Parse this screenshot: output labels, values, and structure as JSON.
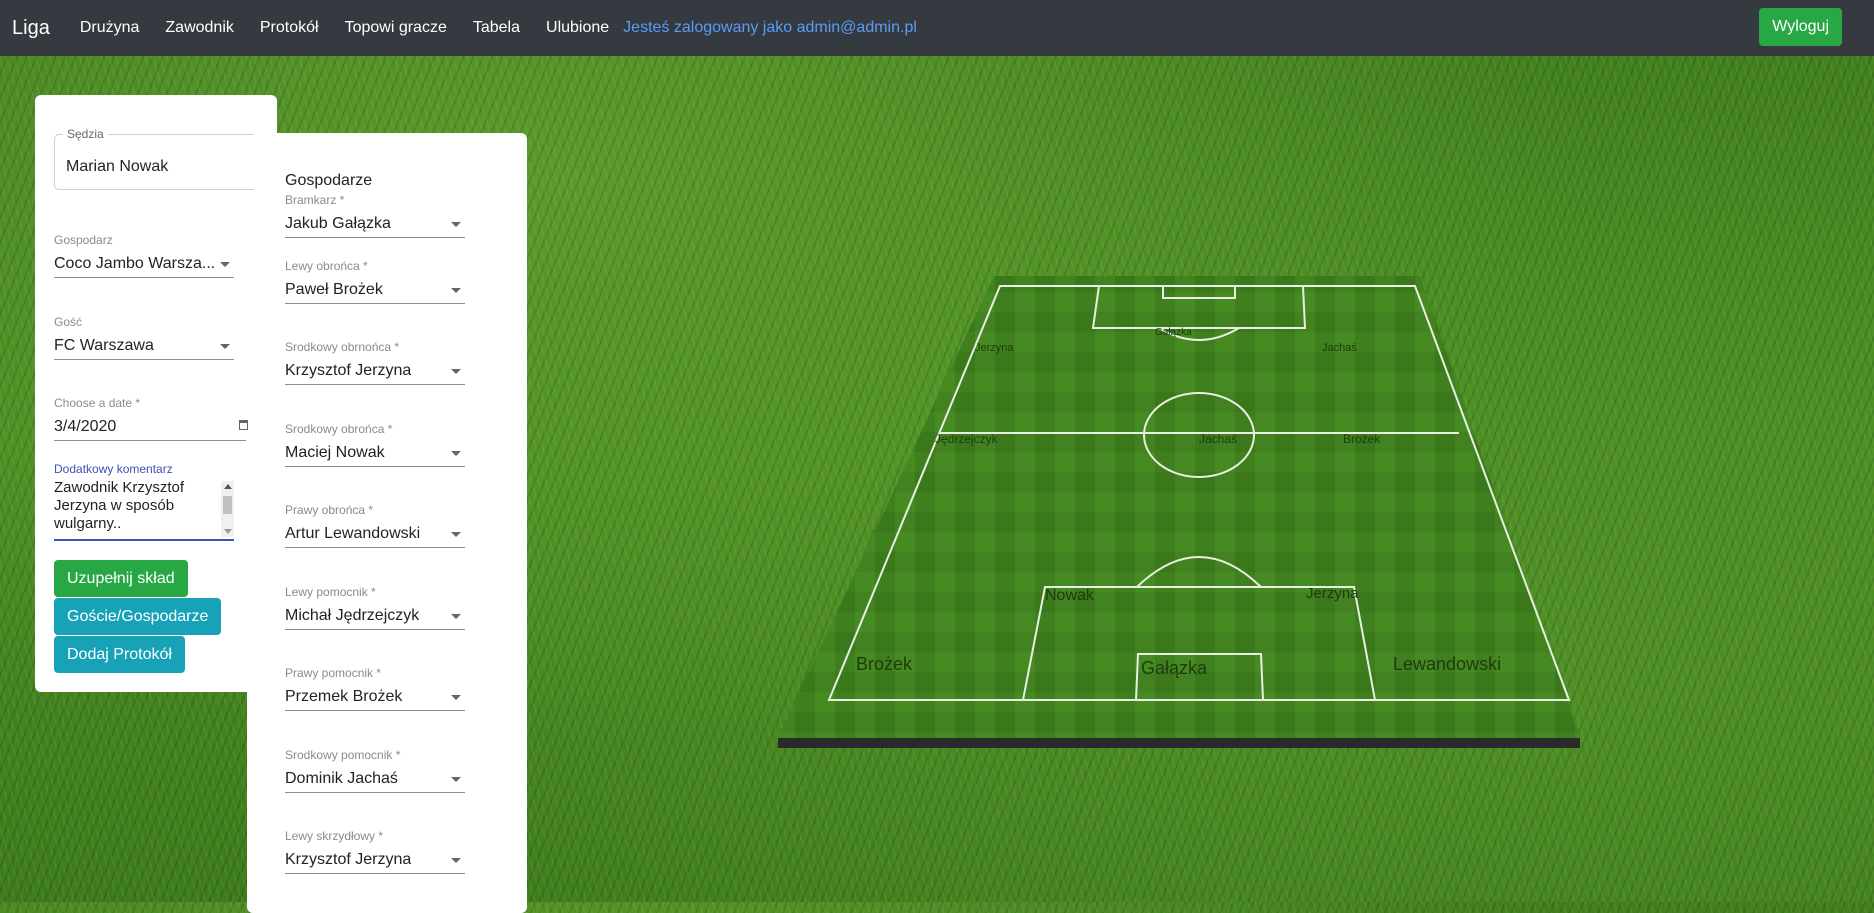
{
  "navbar": {
    "brand": "Liga",
    "links": [
      "Drużyna",
      "Zawodnik",
      "Protokół",
      "Topowi gracze",
      "Tabela",
      "Ulubione"
    ],
    "logged_in_text": "Jesteś zalogowany jako admin@admin.pl",
    "logout_label": "Wyloguj"
  },
  "form": {
    "referee": {
      "label": "Sędzia",
      "value": "Marian Nowak"
    },
    "host": {
      "label": "Gospodarz",
      "value": "Coco Jambo Warsza..."
    },
    "guest": {
      "label": "Gość",
      "value": "FC Warszawa"
    },
    "date": {
      "label": "Choose a date *",
      "value": "3/4/2020"
    },
    "comment": {
      "label": "Dodatkowy komentarz",
      "value": "Zawodnik Krzysztof Jerzyna w sposób wulgarny.."
    },
    "buttons": {
      "fill_squad": "Uzupełnij skład",
      "guests_hosts": "Goście/Gospodarze",
      "add_protocol": "Dodaj Protokół"
    }
  },
  "lineup": {
    "title": "Gospodarze",
    "positions": [
      {
        "label": "Bramkarz *",
        "value": "Jakub Gałązka"
      },
      {
        "label": "Lewy obrońca *",
        "value": "Paweł Brożek"
      },
      {
        "label": "Srodkowy obrnońca  *",
        "value": "Krzysztof Jerzyna"
      },
      {
        "label": "Srodkowy obrońca *",
        "value": "Maciej Nowak"
      },
      {
        "label": "Prawy obrońca *",
        "value": "Artur Lewandowski"
      },
      {
        "label": "Lewy pomocnik *",
        "value": "Michał Jędrzejczyk"
      },
      {
        "label": "Prawy pomocnik *",
        "value": "Przemek Brożek"
      },
      {
        "label": "Srodkowy pomocnik *",
        "value": "Dominik Jachaś"
      },
      {
        "label": "Lewy skrzydłowy *",
        "value": "Krzysztof Jerzyna"
      }
    ]
  },
  "pitch": {
    "far_labels": [
      "Gałązka",
      "Jerzyna",
      "Jachaś",
      "Jędrzejczyk",
      "Jachaś",
      "Brożek"
    ],
    "near_labels": [
      "Nowak",
      "Jerzyna",
      "Brożek",
      "Gałązka",
      "Lewandowski"
    ]
  },
  "colors": {
    "navbar": "#343a40",
    "accent_green": "#28a745",
    "accent_teal": "#17a2b8",
    "link_blue": "#5b9bf5"
  }
}
